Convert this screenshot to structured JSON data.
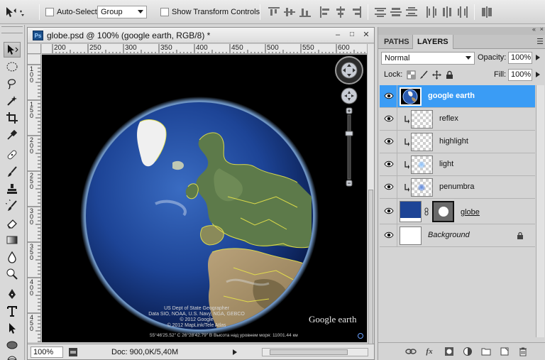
{
  "options_bar": {
    "auto_select_label": "Auto-Select:",
    "auto_select_value": "Group",
    "transform_label": "Show Transform Controls"
  },
  "document": {
    "title": "globe.psd @ 100% (google earth, RGB/8) *",
    "ps_badge": "Ps",
    "zoom": "100%",
    "doc_info": "Doc: 900,0K/5,40M",
    "ruler_top": [
      "200",
      "250",
      "300",
      "350",
      "400",
      "450",
      "500",
      "550",
      "600"
    ],
    "ruler_left": [
      "100",
      "150",
      "200",
      "250",
      "300",
      "350",
      "400",
      "450"
    ],
    "overlay": {
      "credit_1": "US Dept of State Geographer",
      "credit_2": "Data SIO, NOAA, U.S. Navy, NGA, GEBCO",
      "credit_3": "© 2012 Google",
      "credit_4": "© 2012 MapLink/Tele Atlas",
      "logo": "Google earth",
      "coords": "55°46'25.52\" C 26°28'42.79\" В Высота над уровнем моря: 11001.44 км"
    }
  },
  "panel": {
    "tabs": [
      "PATHS",
      "LAYERS"
    ],
    "active_tab": "LAYERS",
    "blend_mode": "Normal",
    "opacity_label": "Opacity:",
    "opacity_value": "100%",
    "lock_label": "Lock:",
    "fill_label": "Fill:",
    "fill_value": "100%",
    "layers": [
      {
        "name": "google earth",
        "selected": true
      },
      {
        "name": "reflex",
        "clipped": true
      },
      {
        "name": "highlight",
        "clipped": true
      },
      {
        "name": "light",
        "clipped": true
      },
      {
        "name": "penumbra",
        "clipped": true
      },
      {
        "name": "globe",
        "mask": true
      },
      {
        "name": "Background",
        "locked": true
      }
    ]
  },
  "colors": {
    "selection": "#3a9cf5",
    "globe_fill": "#1d4496",
    "canvas": "#000000"
  }
}
